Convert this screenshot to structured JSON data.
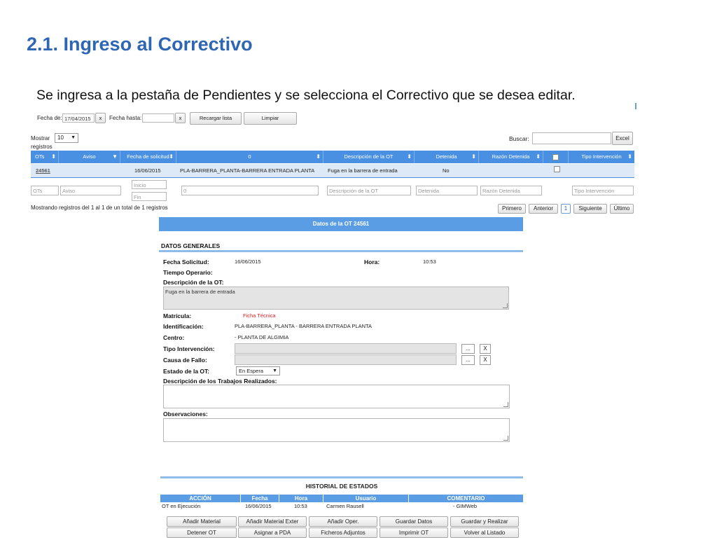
{
  "slide": {
    "title": "2.1. Ingreso al Correctivo",
    "subtitle": "Se ingresa a la pestaña de Pendientes y se selecciona el Correctivo que se desea editar."
  },
  "filters": {
    "fecha_de_label": "Fecha de:",
    "fecha_de_value": "17/04/2015",
    "clear_x": "x",
    "fecha_hasta_label": "Fecha hasta:",
    "fecha_hasta_value": "",
    "recargar_label": "Recargar lista",
    "limpiar_label": "Limpiar"
  },
  "list_controls": {
    "mostrar_label": "Mostrar",
    "mostrar_value": "10",
    "registros_label": "registros",
    "buscar_label": "Buscar:",
    "buscar_value": "",
    "excel_label": "Excel"
  },
  "table": {
    "headers": [
      "OTs",
      "Aviso",
      "Fecha de solicitud",
      "0",
      "Descripción de la OT",
      "Detenida",
      "Razón Detenida",
      "",
      "Tipo Intervención"
    ],
    "row": {
      "ot": "24561",
      "aviso": "",
      "fecha": "16/06/2015",
      "equipo": "PLA-BARRERA_PLANTA-BARRERA ENTRADA PLANTA",
      "descripcion": "Fuga en la barrera de entrada",
      "detenida": "No",
      "razon": "",
      "tipo": ""
    },
    "filter_placeholders": {
      "ots": "OTs",
      "aviso": "Aviso",
      "inicio": "Inicio",
      "fin": "Fin",
      "col0": "0",
      "descripcion": "Descripción de la OT",
      "detenida": "Detenida",
      "razon": "Razón Detenida",
      "tipo": "Tipo Intervención"
    },
    "info": "Mostrando registros del 1 al 1 de un total de 1 registros",
    "pagination": {
      "primero": "Primero",
      "anterior": "Anterior",
      "page": "1",
      "siguiente": "Siguiente",
      "ultimo": "Último"
    }
  },
  "detail": {
    "header": "Datos de la OT 24561",
    "section_title": "DATOS GENERALES",
    "fecha_solicitud_label": "Fecha Solicitud:",
    "fecha_solicitud_value": "16/06/2015",
    "hora_label": "Hora:",
    "hora_value": "10:53",
    "tiempo_operario_label": "Tiempo Operario:",
    "descripcion_label": "Descripción de la OT:",
    "descripcion_value": "Fuga en la barrera de entrada",
    "matricula_label": "Matrícula:",
    "matricula_value": "Ficha Técnica",
    "identificacion_label": "Identificación:",
    "identificacion_value": "PLA-BARRERA_PLANTA - BARRERA ENTRADA PLANTA",
    "centro_label": "Centro:",
    "centro_value": "- PLANTA DE ALGIMIA",
    "tipo_intervencion_label": "Tipo Intervención:",
    "causa_fallo_label": "Causa de Fallo:",
    "ellipsis": "...",
    "x": "X",
    "estado_label": "Estado de la OT:",
    "estado_value": "En Espera",
    "trabajos_label": "Descripción de los Trabajos Realizados:",
    "observaciones_label": "Observaciones:"
  },
  "historial": {
    "title": "HISTORIAL DE ESTADOS",
    "headers": [
      "ACCIÓN",
      "Fecha",
      "Hora",
      "Usuario",
      "COMENTARIO"
    ],
    "row": [
      "OT en Ejecución",
      "16/06/2015",
      "10:53",
      "Carmen Rausell",
      "- GIMWeb"
    ]
  },
  "actions": {
    "row1": [
      "Añadir Material",
      "Añadir Material Exter",
      "Añadir Oper.",
      "Guardar Datos",
      "Guardar y Realizar"
    ],
    "row2": [
      "Detener OT",
      "Asignar a PDA",
      "Ficheros Adjuntos",
      "Imprimir OT",
      "Volver al Listado"
    ]
  },
  "colors": {
    "title_blue": "#2f66b3",
    "header_blue": "#4a90e2",
    "panel_blue": "#5b9de4",
    "row_highlight": "#dde9f7",
    "red_link": "#d22222"
  }
}
